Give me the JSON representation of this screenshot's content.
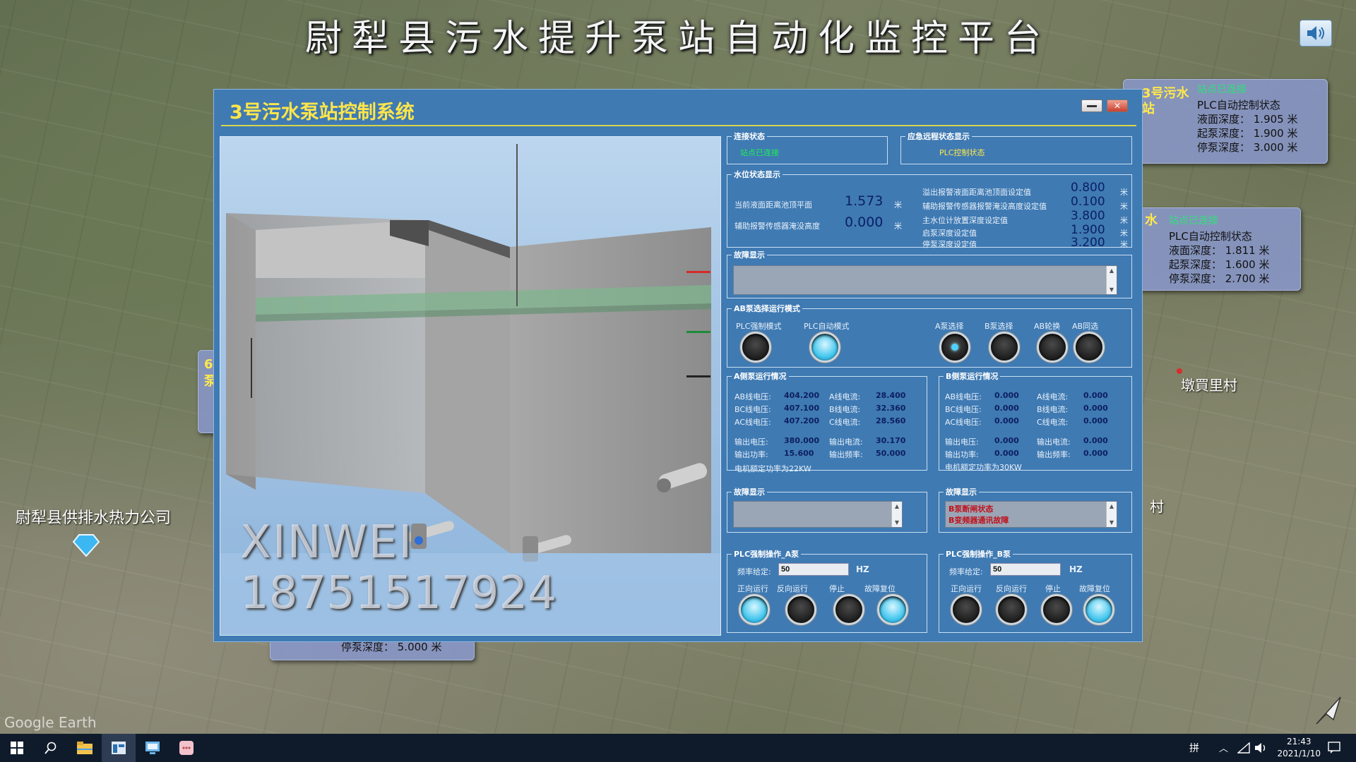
{
  "header": {
    "title": "尉犁县污水提升泵站自动化监控平台",
    "sound_icon": "speaker-icon"
  },
  "map": {
    "company_label": "尉犁县供排水热力公司",
    "village_label": "墩買里村",
    "village_label_2": "村",
    "google_mark": "Google Earth",
    "bubble_right_top": {
      "name_1": "3号污水",
      "name_2": "站",
      "conn": "站点已连接",
      "state": "PLC自动控制状态",
      "level": "液面深度：  1.905 米",
      "start": "起泵深度：  1.900 米",
      "stop": "停泵深度：  3.000 米"
    },
    "bubble_right_mid": {
      "name_1": "水",
      "conn": "站点已连接",
      "state": "PLC自动控制状态",
      "level": "液面深度：   1.811 米",
      "start": "起泵深度：   1.600 米",
      "stop": "停泵深度：   2.700 米"
    },
    "bubble_left_mid": {
      "num": "6",
      "char": "泵"
    },
    "bubble_bottom": {
      "stop": "停泵深度：  5.000 米"
    }
  },
  "dialog": {
    "title": "3号污水泵站控制系统",
    "watermark_1": "XINWEI",
    "watermark_2": "18751517924",
    "connection": {
      "label": "连接状态",
      "value": "站点已连接"
    },
    "remote": {
      "label": "应急远程状态显示",
      "value": "PLC控制状态"
    },
    "water": {
      "label": "水位状态显示",
      "current_label": "当前液面距离池顶平面",
      "current_value": "1.573",
      "current_unit": "米",
      "aux_label": "辅助报警传感器淹没高度",
      "aux_value": "0.000",
      "aux_unit": "米",
      "settings": [
        {
          "label": "溢出报警液面距离池顶面设定值",
          "value": "0.800",
          "unit": "米"
        },
        {
          "label": "辅助报警传感器报警淹没高度设定值",
          "value": "0.100",
          "unit": "米"
        },
        {
          "label": "主水位计放置深度设定值",
          "value": "3.800",
          "unit": "米"
        },
        {
          "label": "启泵深度设定值",
          "value": "1.900",
          "unit": "米"
        },
        {
          "label": "停泵深度设定值",
          "value": "3.200",
          "unit": "米"
        }
      ]
    },
    "fault_main": {
      "label": "故障显示"
    },
    "mode": {
      "label": "AB泵选择运行模式",
      "plc_force": "PLC强制模式",
      "plc_auto": "PLC自动模式",
      "a_select": "A泵选择",
      "b_select": "B泵选择",
      "ab_rotate": "AB轮换",
      "ab_same": "AB同选"
    },
    "pump_a": {
      "label": "A侧泵运行情况",
      "rows": [
        {
          "k1": "AB线电压:",
          "v1": "404.200",
          "k2": "A线电流:",
          "v2": "28.400"
        },
        {
          "k1": "BC线电压:",
          "v1": "407.100",
          "k2": "B线电流:",
          "v2": "32.360"
        },
        {
          "k1": "AC线电压:",
          "v1": "407.200",
          "k2": "C线电流:",
          "v2": "28.560"
        },
        {
          "k1": "输出电压:",
          "v1": "380.000",
          "k2": "输出电流:",
          "v2": "30.170"
        },
        {
          "k1": "输出功率:",
          "v1": "15.600",
          "k2": "输出频率:",
          "v2": "50.000"
        }
      ],
      "rated": "电机额定功率为22KW"
    },
    "pump_b": {
      "label": "B侧泵运行情况",
      "rows": [
        {
          "k1": "AB线电压:",
          "v1": "0.000",
          "k2": "A线电流:",
          "v2": "0.000"
        },
        {
          "k1": "BC线电压:",
          "v1": "0.000",
          "k2": "B线电流:",
          "v2": "0.000"
        },
        {
          "k1": "AC线电压:",
          "v1": "0.000",
          "k2": "C线电流:",
          "v2": "0.000"
        },
        {
          "k1": "输出电压:",
          "v1": "0.000",
          "k2": "输出电流:",
          "v2": "0.000"
        },
        {
          "k1": "输出功率:",
          "v1": "0.000",
          "k2": "输出频率:",
          "v2": "0.000"
        }
      ],
      "rated": "电机额定功率为30KW"
    },
    "fault_a": {
      "label": "故障显示"
    },
    "fault_b": {
      "label": "故障显示",
      "line1": "B泵断闸状态",
      "line2": "B变频器通讯故障"
    },
    "ctrl_a": {
      "label": "PLC强制操作_A泵",
      "freq_label": "频率给定:",
      "freq_value": "50",
      "unit": "HZ",
      "fwd": "正向运行",
      "rev": "反向运行",
      "stop": "停止",
      "reset": "故障复位"
    },
    "ctrl_b": {
      "label": "PLC强制操作_B泵",
      "freq_label": "频率给定:",
      "freq_value": "50",
      "unit": "HZ",
      "fwd": "正向运行",
      "rev": "反向运行",
      "stop": "停止",
      "reset": "故障复位"
    }
  },
  "taskbar": {
    "time": "21:43",
    "date": "2021/1/10",
    "ime": "拼"
  }
}
